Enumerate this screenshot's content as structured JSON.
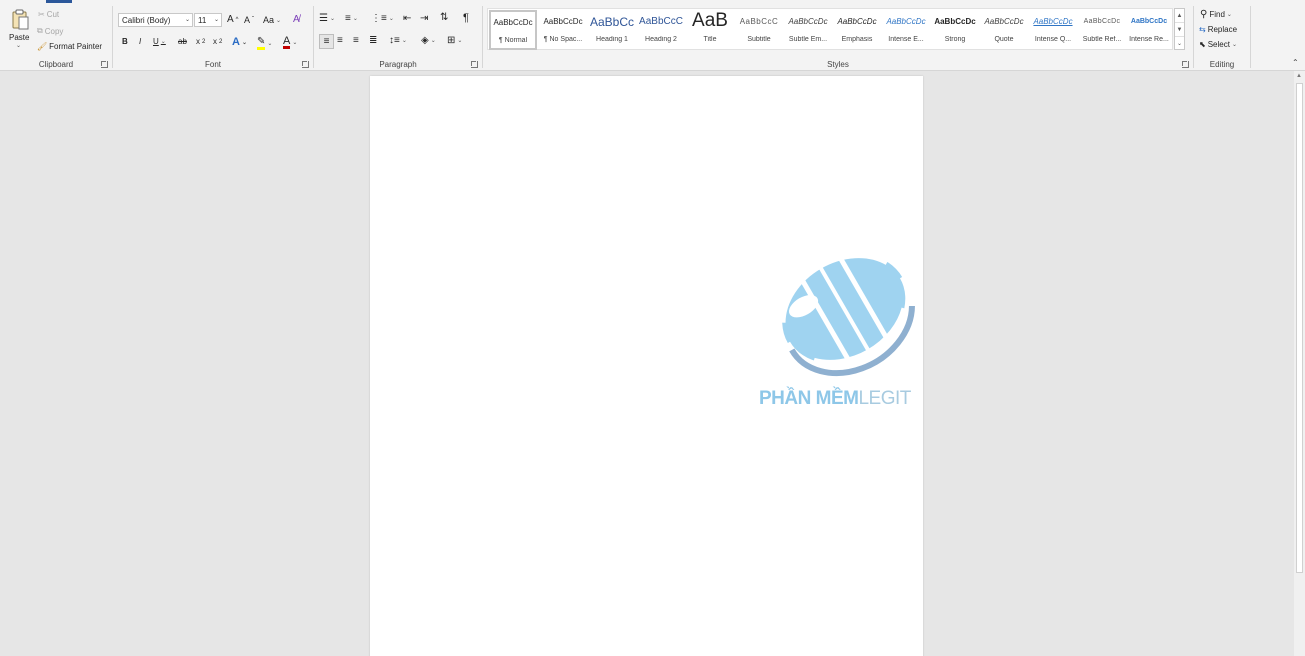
{
  "clipboard": {
    "paste_label": "Paste",
    "cut_label": "Cut",
    "copy_label": "Copy",
    "format_painter_label": "Format Painter",
    "group_label": "Clipboard"
  },
  "font": {
    "font_name": "Calibri (Body)",
    "font_size": "11",
    "grow_label": "A",
    "shrink_label": "A",
    "case_label": "Aa",
    "bold": "B",
    "italic": "I",
    "underline": "U",
    "strike": "ab",
    "subscript": "x",
    "superscript": "x",
    "text_effects": "A",
    "font_color": "A",
    "group_label": "Font"
  },
  "paragraph": {
    "group_label": "Paragraph"
  },
  "styles": {
    "group_label": "Styles",
    "items": [
      {
        "preview": "AaBbCcDc",
        "name": "¶ Normal"
      },
      {
        "preview": "AaBbCcDc",
        "name": "¶ No Spac..."
      },
      {
        "preview": "AaBbCc",
        "name": "Heading 1"
      },
      {
        "preview": "AaBbCcC",
        "name": "Heading 2"
      },
      {
        "preview": "AaB",
        "name": "Title"
      },
      {
        "preview": "AaBbCcC",
        "name": "Subtitle"
      },
      {
        "preview": "AaBbCcDc",
        "name": "Subtle Em..."
      },
      {
        "preview": "AaBbCcDc",
        "name": "Emphasis"
      },
      {
        "preview": "AaBbCcDc",
        "name": "Intense E..."
      },
      {
        "preview": "AaBbCcDc",
        "name": "Strong"
      },
      {
        "preview": "AaBbCcDc",
        "name": "Quote"
      },
      {
        "preview": "AaBbCcDc",
        "name": "Intense Q..."
      },
      {
        "preview": "AaBbCcDc",
        "name": "Subtle Ref..."
      },
      {
        "preview": "AaBbCcDc",
        "name": "Intense Re..."
      }
    ]
  },
  "editing": {
    "find_label": "Find",
    "replace_label": "Replace",
    "select_label": "Select",
    "group_label": "Editing"
  },
  "watermark": {
    "brand_a": "PHẦN MỀM",
    "brand_b": "LEGIT"
  },
  "colors": {
    "accent": "#2b579a",
    "highlight": "#ffff00",
    "font_color": "#c00000"
  }
}
